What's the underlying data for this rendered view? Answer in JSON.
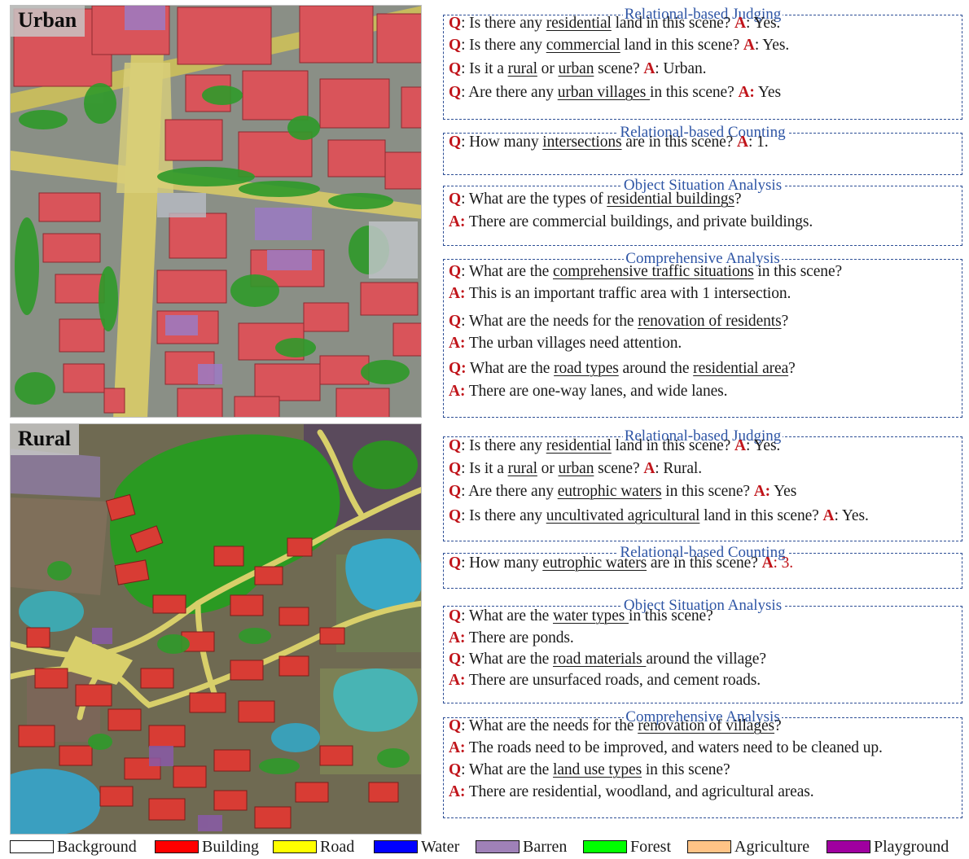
{
  "scenes": [
    {
      "label": "Urban",
      "panels": [
        {
          "title": "Relational-based Judging",
          "items": [
            {
              "mark": "Q",
              "parts": [
                {
                  "t": ": Is there any "
                },
                {
                  "t": "residential",
                  "u": true
                },
                {
                  "t": " land in this scene? "
                }
              ],
              "amark": "A",
              "answer": ": Yes."
            },
            {
              "mark": "Q",
              "parts": [
                {
                  "t": ": Is there any "
                },
                {
                  "t": "commercial",
                  "u": true
                },
                {
                  "t": " land in this scene? "
                }
              ],
              "amark": "A",
              "answer": ": Yes."
            },
            {
              "mark": "Q",
              "parts": [
                {
                  "t": ": Is it a "
                },
                {
                  "t": "rural",
                  "u": true
                },
                {
                  "t": " or "
                },
                {
                  "t": "urban",
                  "u": true
                },
                {
                  "t": " scene? "
                }
              ],
              "amark": "A",
              "answer": ": Urban."
            },
            {
              "mark": "Q",
              "parts": [
                {
                  "t": ": Are there any "
                },
                {
                  "t": "urban villages ",
                  "u": true
                },
                {
                  "t": "in this scene? "
                }
              ],
              "amark": "A:",
              "answer": " Yes"
            }
          ]
        },
        {
          "title": "Relational-based Counting",
          "items": [
            {
              "mark": "Q",
              "parts": [
                {
                  "t": ": How many "
                },
                {
                  "t": "intersections",
                  "u": true
                },
                {
                  "t": " are in this scene? "
                }
              ],
              "amark": "A",
              "answer": ": 1."
            }
          ]
        },
        {
          "title": "Object Situation Analysis",
          "items": [
            {
              "mark": "Q",
              "parts": [
                {
                  "t": ": What are the types of "
                },
                {
                  "t": "residential buildings",
                  "u": true
                },
                {
                  "t": "?"
                }
              ]
            },
            {
              "mark": "A:",
              "parts": [
                {
                  "t": " There are commercial buildings, and private buildings."
                }
              ]
            }
          ]
        },
        {
          "title": "Comprehensive Analysis",
          "items": [
            {
              "mark": "Q",
              "parts": [
                {
                  "t": ": What are the "
                },
                {
                  "t": "comprehensive traffic situations",
                  "u": true
                },
                {
                  "t": " in this scene?"
                }
              ]
            },
            {
              "mark": "A:",
              "parts": [
                {
                  "t": " This is an important traffic area with 1 intersection."
                }
              ]
            },
            {
              "mark": "Q",
              "parts": [
                {
                  "t": ": What are the needs for the "
                },
                {
                  "t": "renovation of residents",
                  "u": true
                },
                {
                  "t": "?"
                }
              ]
            },
            {
              "mark": "A:",
              "parts": [
                {
                  "t": " The urban villages need attention."
                }
              ]
            },
            {
              "mark": "Q:",
              "parts": [
                {
                  "t": " What are the "
                },
                {
                  "t": "road types",
                  "u": true
                },
                {
                  "t": " around the "
                },
                {
                  "t": "residential area",
                  "u": true
                },
                {
                  "t": "?"
                }
              ]
            },
            {
              "mark": "A:",
              "parts": [
                {
                  "t": " There are one-way lanes, and wide lanes."
                }
              ]
            }
          ]
        }
      ]
    },
    {
      "label": "Rural",
      "panels": [
        {
          "title": "Relational-based Judging",
          "items": [
            {
              "mark": "Q",
              "parts": [
                {
                  "t": ": Is there any "
                },
                {
                  "t": "residential",
                  "u": true
                },
                {
                  "t": " land in this scene? "
                }
              ],
              "amark": "A",
              "answer": ": Yes."
            },
            {
              "mark": "Q",
              "parts": [
                {
                  "t": ": Is it a "
                },
                {
                  "t": "rural",
                  "u": true
                },
                {
                  "t": " or "
                },
                {
                  "t": "urban",
                  "u": true
                },
                {
                  "t": " scene? "
                }
              ],
              "amark": "A",
              "answer": ": Rural."
            },
            {
              "mark": "Q",
              "parts": [
                {
                  "t": ": Are there any "
                },
                {
                  "t": "eutrophic waters",
                  "u": true
                },
                {
                  "t": " in this scene? "
                }
              ],
              "amark": "A:",
              "answer": " Yes"
            },
            {
              "mark": "Q",
              "parts": [
                {
                  "t": ": Is there any "
                },
                {
                  "t": "uncultivated agricultural",
                  "u": true
                },
                {
                  "t": " land in this scene? "
                }
              ],
              "amark": "A",
              "answer": ": Yes."
            }
          ]
        },
        {
          "title": "Relational-based Counting",
          "items": [
            {
              "mark": "Q",
              "parts": [
                {
                  "t": ": How many "
                },
                {
                  "t": "eutrophic waters",
                  "u": true
                },
                {
                  "t": " are in this scene? "
                }
              ],
              "amark": "A",
              "answer": ": 3.",
              "answer_red": true
            }
          ]
        },
        {
          "title": "Object Situation Analysis",
          "items": [
            {
              "mark": "Q",
              "parts": [
                {
                  "t": ": What are the "
                },
                {
                  "t": "water types ",
                  "u": true
                },
                {
                  "t": "in this scene?"
                }
              ]
            },
            {
              "mark": "A:",
              "parts": [
                {
                  "t": " There are ponds."
                }
              ]
            },
            {
              "mark": "Q",
              "parts": [
                {
                  "t": ": What are the "
                },
                {
                  "t": "road materials ",
                  "u": true
                },
                {
                  "t": "around the village?"
                }
              ]
            },
            {
              "mark": "A:",
              "parts": [
                {
                  "t": " There are unsurfaced roads, and cement roads."
                }
              ]
            }
          ]
        },
        {
          "title": "Comprehensive Analysis",
          "items": [
            {
              "mark": "Q",
              "parts": [
                {
                  "t": ": What are the needs for the "
                },
                {
                  "t": "renovation of villages",
                  "u": true
                },
                {
                  "t": "?"
                }
              ]
            },
            {
              "mark": "A:",
              "parts": [
                {
                  "t": " The roads need to be improved, and waters need to be cleaned up."
                }
              ]
            },
            {
              "mark": "Q",
              "parts": [
                {
                  "t": ": What are the "
                },
                {
                  "t": "land use types",
                  "u": true
                },
                {
                  "t": " in this scene?"
                }
              ]
            },
            {
              "mark": "A:",
              "parts": [
                {
                  "t": " There are residential, woodland, and agricultural areas."
                }
              ]
            }
          ]
        }
      ]
    }
  ],
  "legend": [
    {
      "label": "Background",
      "color": "#ffffff"
    },
    {
      "label": "Building",
      "color": "#ff0000"
    },
    {
      "label": "Road",
      "color": "#ffff00"
    },
    {
      "label": "Water",
      "color": "#0000ff"
    },
    {
      "label": "Barren",
      "color": "#9f81b8"
    },
    {
      "label": "Forest",
      "color": "#00ff00"
    },
    {
      "label": "Agriculture",
      "color": "#ffc386"
    },
    {
      "label": "Playground",
      "color": "#a000a0"
    }
  ]
}
